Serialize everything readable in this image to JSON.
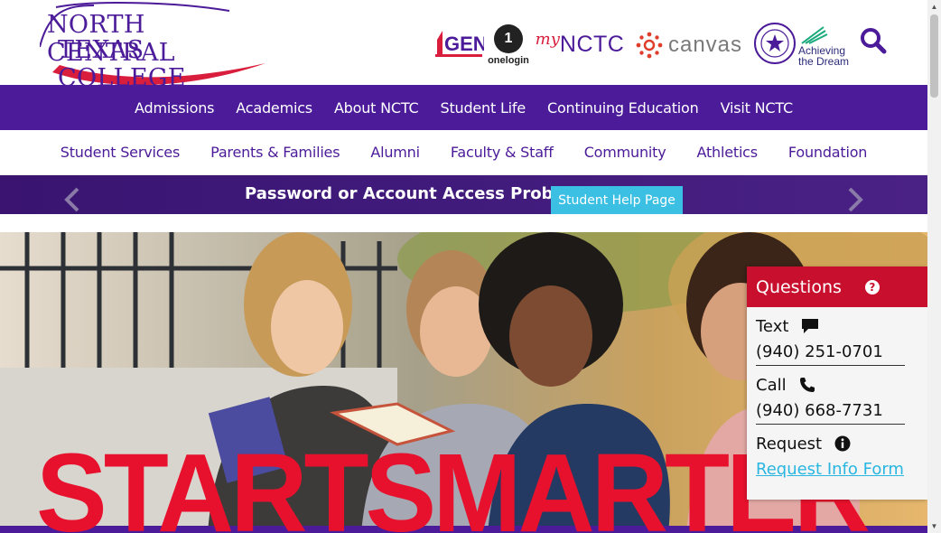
{
  "header": {
    "logo_line1": "NORTH CENTRAL",
    "logo_line2": "TEXAS COLLEGE",
    "partners": {
      "gen": "GEN",
      "onelogin_badge": "1",
      "onelogin": "onelogin",
      "mynctc_my": "my",
      "mynctc_nctc": "NCTC",
      "canvas": "canvas",
      "atd_line1": "Achieving",
      "atd_line2": "the Dream"
    },
    "search_icon": "search-icon"
  },
  "nav_main": [
    "Admissions",
    "Academics",
    "About NCTC",
    "Student Life",
    "Continuing Education",
    "Visit NCTC"
  ],
  "nav_sub": [
    "Student Services",
    "Parents & Families",
    "Alumni",
    "Faculty & Staff",
    "Community",
    "Athletics",
    "Foundation"
  ],
  "alert": {
    "text": "Password or Account Access Problem?",
    "button": "Student Help Page"
  },
  "hero": {
    "headline": "STARTSMARTER"
  },
  "questions": {
    "title": "Questions",
    "text_label": "Text",
    "text_number": "(940) 251-0701",
    "call_label": "Call",
    "call_number": "(940) 668-7731",
    "request_label": "Request",
    "request_link": "Request Info Form"
  },
  "colors": {
    "brand_purple": "#4b1b99",
    "brand_red": "#c8102e",
    "alert_button": "#3bbfe3",
    "link": "#29b6e0"
  }
}
